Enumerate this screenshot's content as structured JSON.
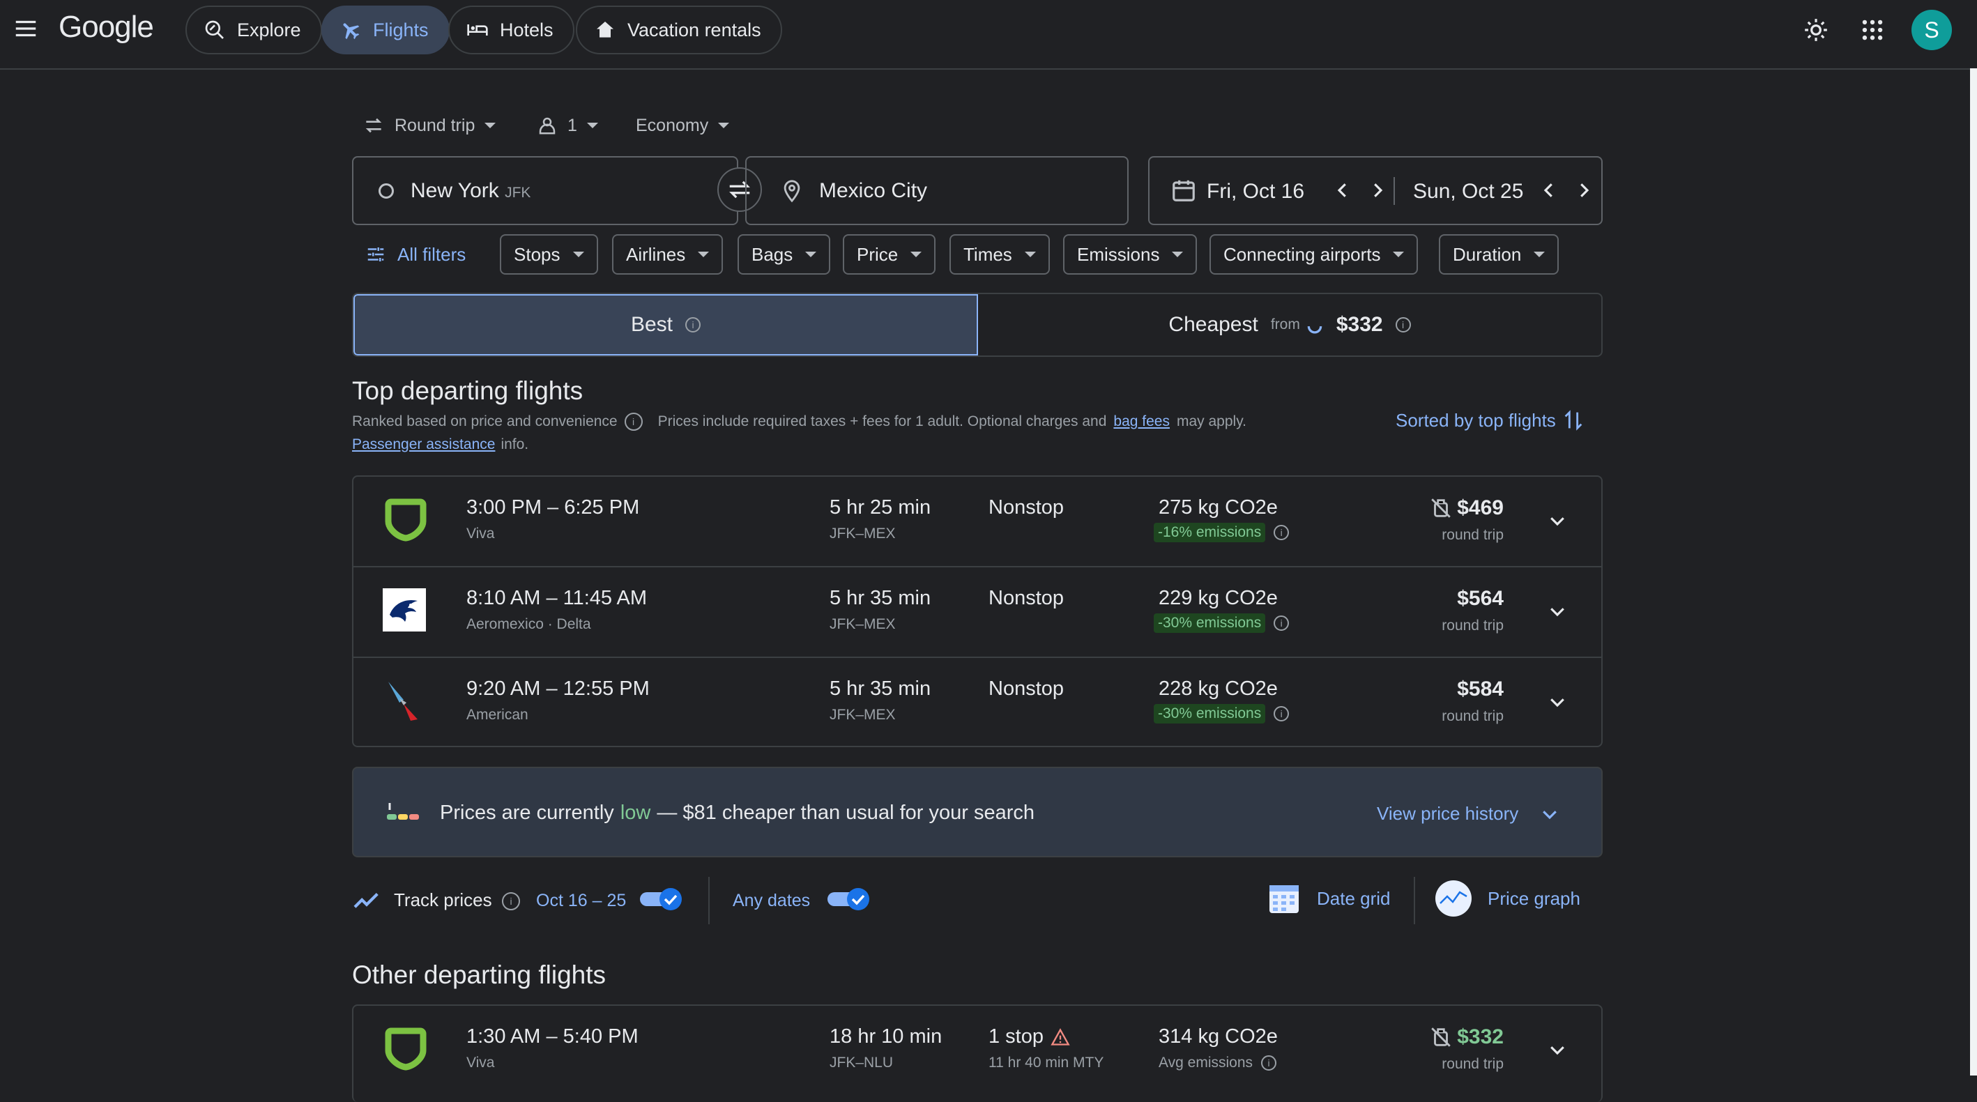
{
  "header": {
    "logo": "Google",
    "nav": [
      {
        "label": "Explore",
        "icon": "explore-icon"
      },
      {
        "label": "Flights",
        "icon": "flight-icon",
        "active": true
      },
      {
        "label": "Hotels",
        "icon": "hotel-icon"
      },
      {
        "label": "Vacation rentals",
        "icon": "home-icon"
      }
    ],
    "avatar": "S"
  },
  "search": {
    "trip_type": "Round trip",
    "passengers": "1",
    "cabin": "Economy",
    "origin": "New York",
    "origin_code": "JFK",
    "destination": "Mexico City",
    "depart_date": "Fri, Oct 16",
    "return_date": "Sun, Oct 25"
  },
  "filters": {
    "all": "All filters",
    "chips": [
      "Stops",
      "Airlines",
      "Bags",
      "Price",
      "Times",
      "Emissions",
      "Connecting airports",
      "Duration"
    ]
  },
  "sort_tabs": {
    "best": "Best",
    "cheapest": "Cheapest",
    "cheapest_from": "from",
    "cheapest_price": "$332"
  },
  "top": {
    "title": "Top departing flights",
    "ranked": "Ranked based on price and convenience",
    "prices_note_pre": "Prices include required taxes + fees for 1 adult. Optional charges and",
    "bag_fees": "bag fees",
    "prices_note_post": "may apply.",
    "passenger_assistance": "Passenger assistance",
    "info": "info.",
    "sorted": "Sorted by top flights"
  },
  "top_flights": [
    {
      "time": "3:00 PM – 6:25 PM",
      "airline": "Viva",
      "duration": "5 hr 25 min",
      "route": "JFK–MEX",
      "stops": "Nonstop",
      "co2": "275 kg CO2e",
      "emissions": "-16% emissions",
      "price": "$469",
      "price_note": "round trip",
      "logo": "viva-logo"
    },
    {
      "time": "8:10 AM – 11:45 AM",
      "airline": "Aeromexico · Delta",
      "duration": "5 hr 35 min",
      "route": "JFK–MEX",
      "stops": "Nonstop",
      "co2": "229 kg CO2e",
      "emissions": "-30% emissions",
      "price": "$564",
      "price_note": "round trip",
      "logo": "aeromexico-logo"
    },
    {
      "time": "9:20 AM – 12:55 PM",
      "airline": "American",
      "duration": "5 hr 35 min",
      "route": "JFK–MEX",
      "stops": "Nonstop",
      "co2": "228 kg CO2e",
      "emissions": "-30% emissions",
      "price": "$584",
      "price_note": "round trip",
      "logo": "american-logo"
    }
  ],
  "insight": {
    "pre": "Prices are currently",
    "level": "low",
    "post": "— $81 cheaper than usual for your search",
    "history": "View price history"
  },
  "track": {
    "label": "Track prices",
    "dates": "Oct 16 – 25",
    "any_dates": "Any dates",
    "date_grid": "Date grid",
    "price_graph": "Price graph"
  },
  "other": {
    "title": "Other departing flights"
  },
  "other_flights": [
    {
      "time": "1:30 AM – 5:40 PM",
      "airline": "Viva",
      "duration": "18 hr 10 min",
      "route": "JFK–NLU",
      "stops": "1 stop",
      "stop_detail": "11 hr 40 min MTY",
      "co2": "314 kg CO2e",
      "emissions": "Avg emissions",
      "price": "$332",
      "price_note": "round trip",
      "logo": "viva-logo"
    }
  ],
  "colors": {
    "background": "#202124",
    "accent": "#8ab4f8",
    "good": "#81c995"
  }
}
